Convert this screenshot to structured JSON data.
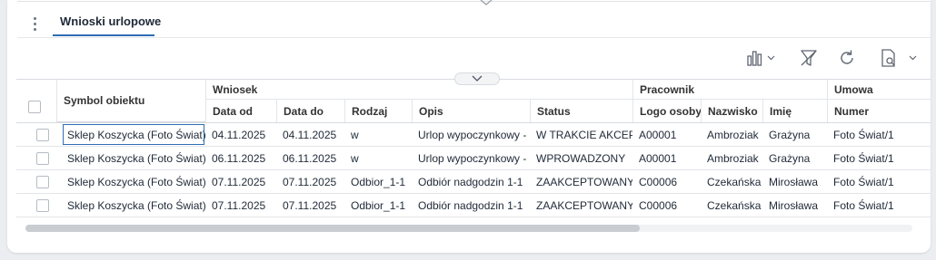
{
  "tabs": [
    {
      "label": "Wnioski urlopowe",
      "active": true
    }
  ],
  "toolbar": {
    "icons": [
      "chart-icon",
      "chevron-down-icon",
      "filter-clear-icon",
      "refresh-icon",
      "document-search-icon",
      "chevron-down-icon"
    ]
  },
  "grid": {
    "group_headers": {
      "symbol": "Symbol obiektu",
      "wniosek": "Wniosek",
      "pracownik": "Pracownik",
      "umowa": "Umowa"
    },
    "columns": {
      "data_od": "Data od",
      "data_do": "Data do",
      "rodzaj": "Rodzaj",
      "opis": "Opis",
      "status": "Status",
      "logo": "Logo osoby",
      "nazwisko": "Nazwisko",
      "imie": "Imię",
      "numer": "Numer"
    },
    "rows": [
      {
        "symbol": "Sklep Koszycka (Foto Świat)",
        "data_od": "04.11.2025",
        "data_do": "04.11.2025",
        "rodzaj": "w",
        "opis": "Urlop wypoczynkowy - I",
        "status": "W TRAKCIE AKCEPT",
        "logo": "A00001",
        "nazwisko": "Ambroziak",
        "imie": "Grażyna",
        "numer": "Foto Świat/1"
      },
      {
        "symbol": "Sklep Koszycka (Foto Świat)",
        "data_od": "06.11.2025",
        "data_do": "06.11.2025",
        "rodzaj": "w",
        "opis": "Urlop wypoczynkowy - I",
        "status": "WPROWADZONY",
        "logo": "A00001",
        "nazwisko": "Ambroziak",
        "imie": "Grażyna",
        "numer": "Foto Świat/1"
      },
      {
        "symbol": "Sklep Koszycka (Foto Świat)",
        "data_od": "07.11.2025",
        "data_do": "07.11.2025",
        "rodzaj": "Odbior_1-1",
        "opis": "Odbiór nadgodzin 1-1",
        "status": "ZAAKCEPTOWANY",
        "logo": "C00006",
        "nazwisko": "Czekańska",
        "imie": "Mirosława",
        "numer": "Foto Świat/1"
      },
      {
        "symbol": "Sklep Koszycka (Foto Świat)",
        "data_od": "07.11.2025",
        "data_do": "07.11.2025",
        "rodzaj": "Odbior_1-1",
        "opis": "Odbiór nadgodzin 1-1",
        "status": "ZAAKCEPTOWANY",
        "logo": "C00006",
        "nazwisko": "Czekańska",
        "imie": "Mirosława",
        "numer": "Foto Świat/1"
      }
    ]
  },
  "colors": {
    "accent": "#2f6db3",
    "border": "#d7dbe0"
  }
}
